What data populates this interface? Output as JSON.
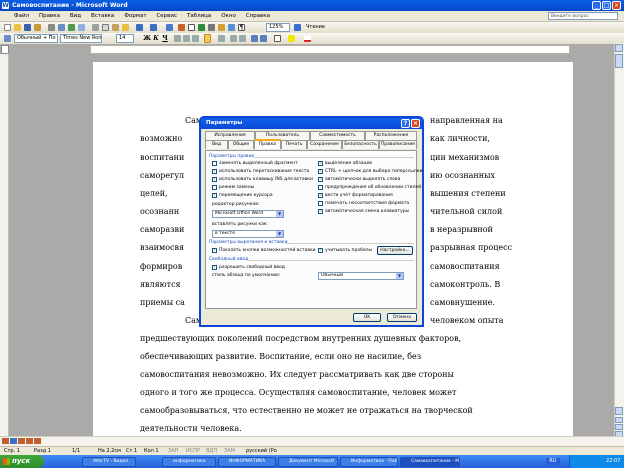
{
  "window": {
    "title": "Самовоспитание - Microsoft Word",
    "min": "_",
    "max": "□",
    "close": "×"
  },
  "menu": {
    "items": [
      "Файл",
      "Правка",
      "Вид",
      "Вставка",
      "Формат",
      "Сервис",
      "Таблица",
      "Окно",
      "Справка"
    ],
    "help_placeholder": "Введите вопрос"
  },
  "toolbar": {
    "zoom": "125%",
    "reading_mode": "Чтение"
  },
  "format": {
    "style": "Обычный + По ш",
    "font": "Times New Roman",
    "size": "14",
    "bold": "Ж",
    "italic": "К",
    "underline": "Ч"
  },
  "document": {
    "lines": [
      "Сам",
      "возможно",
      "воспитани",
      "саморегул",
      "целей, ",
      "осознанн",
      "саморазви",
      "взаимосвя",
      "формиров",
      "являются",
      "приемы са",
      "Сам",
      "предшествующих поколений посредством внутренних душевных факторов,",
      "обеспечивающих развитие. Воспитание, если оно не насилие, без",
      "самовоспитания невозможно. Их следует рассматривать как две стороны",
      "одного и того же процесса. Осуществляя самовоспитание, человек может",
      "самообразовываться, что естественно не может не отражаться на творческой",
      "деятельности человека."
    ],
    "right_fragments": [
      "направленная на",
      "как личности,",
      "ции механизмов",
      "ию осознанных",
      "вышения степени",
      "чительной силой",
      "в неразрывной",
      "разрывная процесс",
      "самовоспитания",
      "самоконтроль. В",
      "самовнушение.",
      "человеком опыта"
    ]
  },
  "dialog": {
    "title": "Параметры",
    "help": "?",
    "close": "×",
    "tabs_row1": [
      "Исправления",
      "Пользователь",
      "Совместимость",
      "Расположение"
    ],
    "tabs_row2": [
      "Вид",
      "Общие",
      "Правка",
      "Печать",
      "Сохранение",
      "Безопасность",
      "Правописание"
    ],
    "selected_tab": "Правка",
    "group_edit": "Параметры правки",
    "left_checks": [
      {
        "label": "заменять выделенный фрагмент",
        "checked": false
      },
      {
        "label": "использовать перетаскивание текста",
        "checked": true
      },
      {
        "label": "использовать клавишу INS для вставки",
        "checked": true
      },
      {
        "label": "режим замены",
        "checked": false
      },
      {
        "label": "перемещение курсора",
        "checked": true
      }
    ],
    "right_checks": [
      {
        "label": "выделение абзацев",
        "checked": true
      },
      {
        "label": "CTRL + щелчок для выбора гиперссылки",
        "checked": true
      },
      {
        "label": "автоматически выделять слова",
        "checked": true
      },
      {
        "label": "предупреждения об обновлении стилей",
        "checked": false
      },
      {
        "label": "вести учет форматирования",
        "checked": true
      },
      {
        "label": "помечать несоответствия формата",
        "checked": false
      },
      {
        "label": "автоматическая смена клавиатуры",
        "checked": true
      }
    ],
    "editor_label": "редактор рисунков:",
    "editor_value": "Microsoft Office Word",
    "insert_label": "вставлять рисунки как:",
    "insert_value": "в тексте",
    "group_cut": "Параметры вырезания и вставки",
    "show_buttons": {
      "label": "Показать кнопки возможностей вставки",
      "checked": true
    },
    "smart_space": {
      "label": "учитывать пробелы",
      "checked": true
    },
    "settings_button": "Настройка...",
    "group_free": "Свободный ввод",
    "free_input": {
      "label": "разрешить свободный ввод",
      "checked": true
    },
    "default_style_label": "стиль абзаца по умолчанию:",
    "default_style_value": "Обычный",
    "ok": "OK",
    "cancel": "Отмена",
    "check_mark": "✓"
  },
  "status": {
    "page": "Стр. 1",
    "section": "Разд 1",
    "pages": "1/1",
    "at": "На 2,2см",
    "line": "Ст 1",
    "col": "Кол 1",
    "rec": "ЗАП",
    "trk": "ИСПР",
    "ext": "ВДЛ",
    "ovr": "ЗАМ",
    "lang": "русский (Ро"
  },
  "taskbar": {
    "start": "пуск",
    "tasks": [
      "AVerTV - Видео",
      "информатика",
      "ИНФОРМАТИКА",
      "Документ Microsoft ...",
      "Информатика - Паб...",
      "Самовоспитание - Mi..."
    ],
    "lang": "RU",
    "time": "22:07"
  }
}
